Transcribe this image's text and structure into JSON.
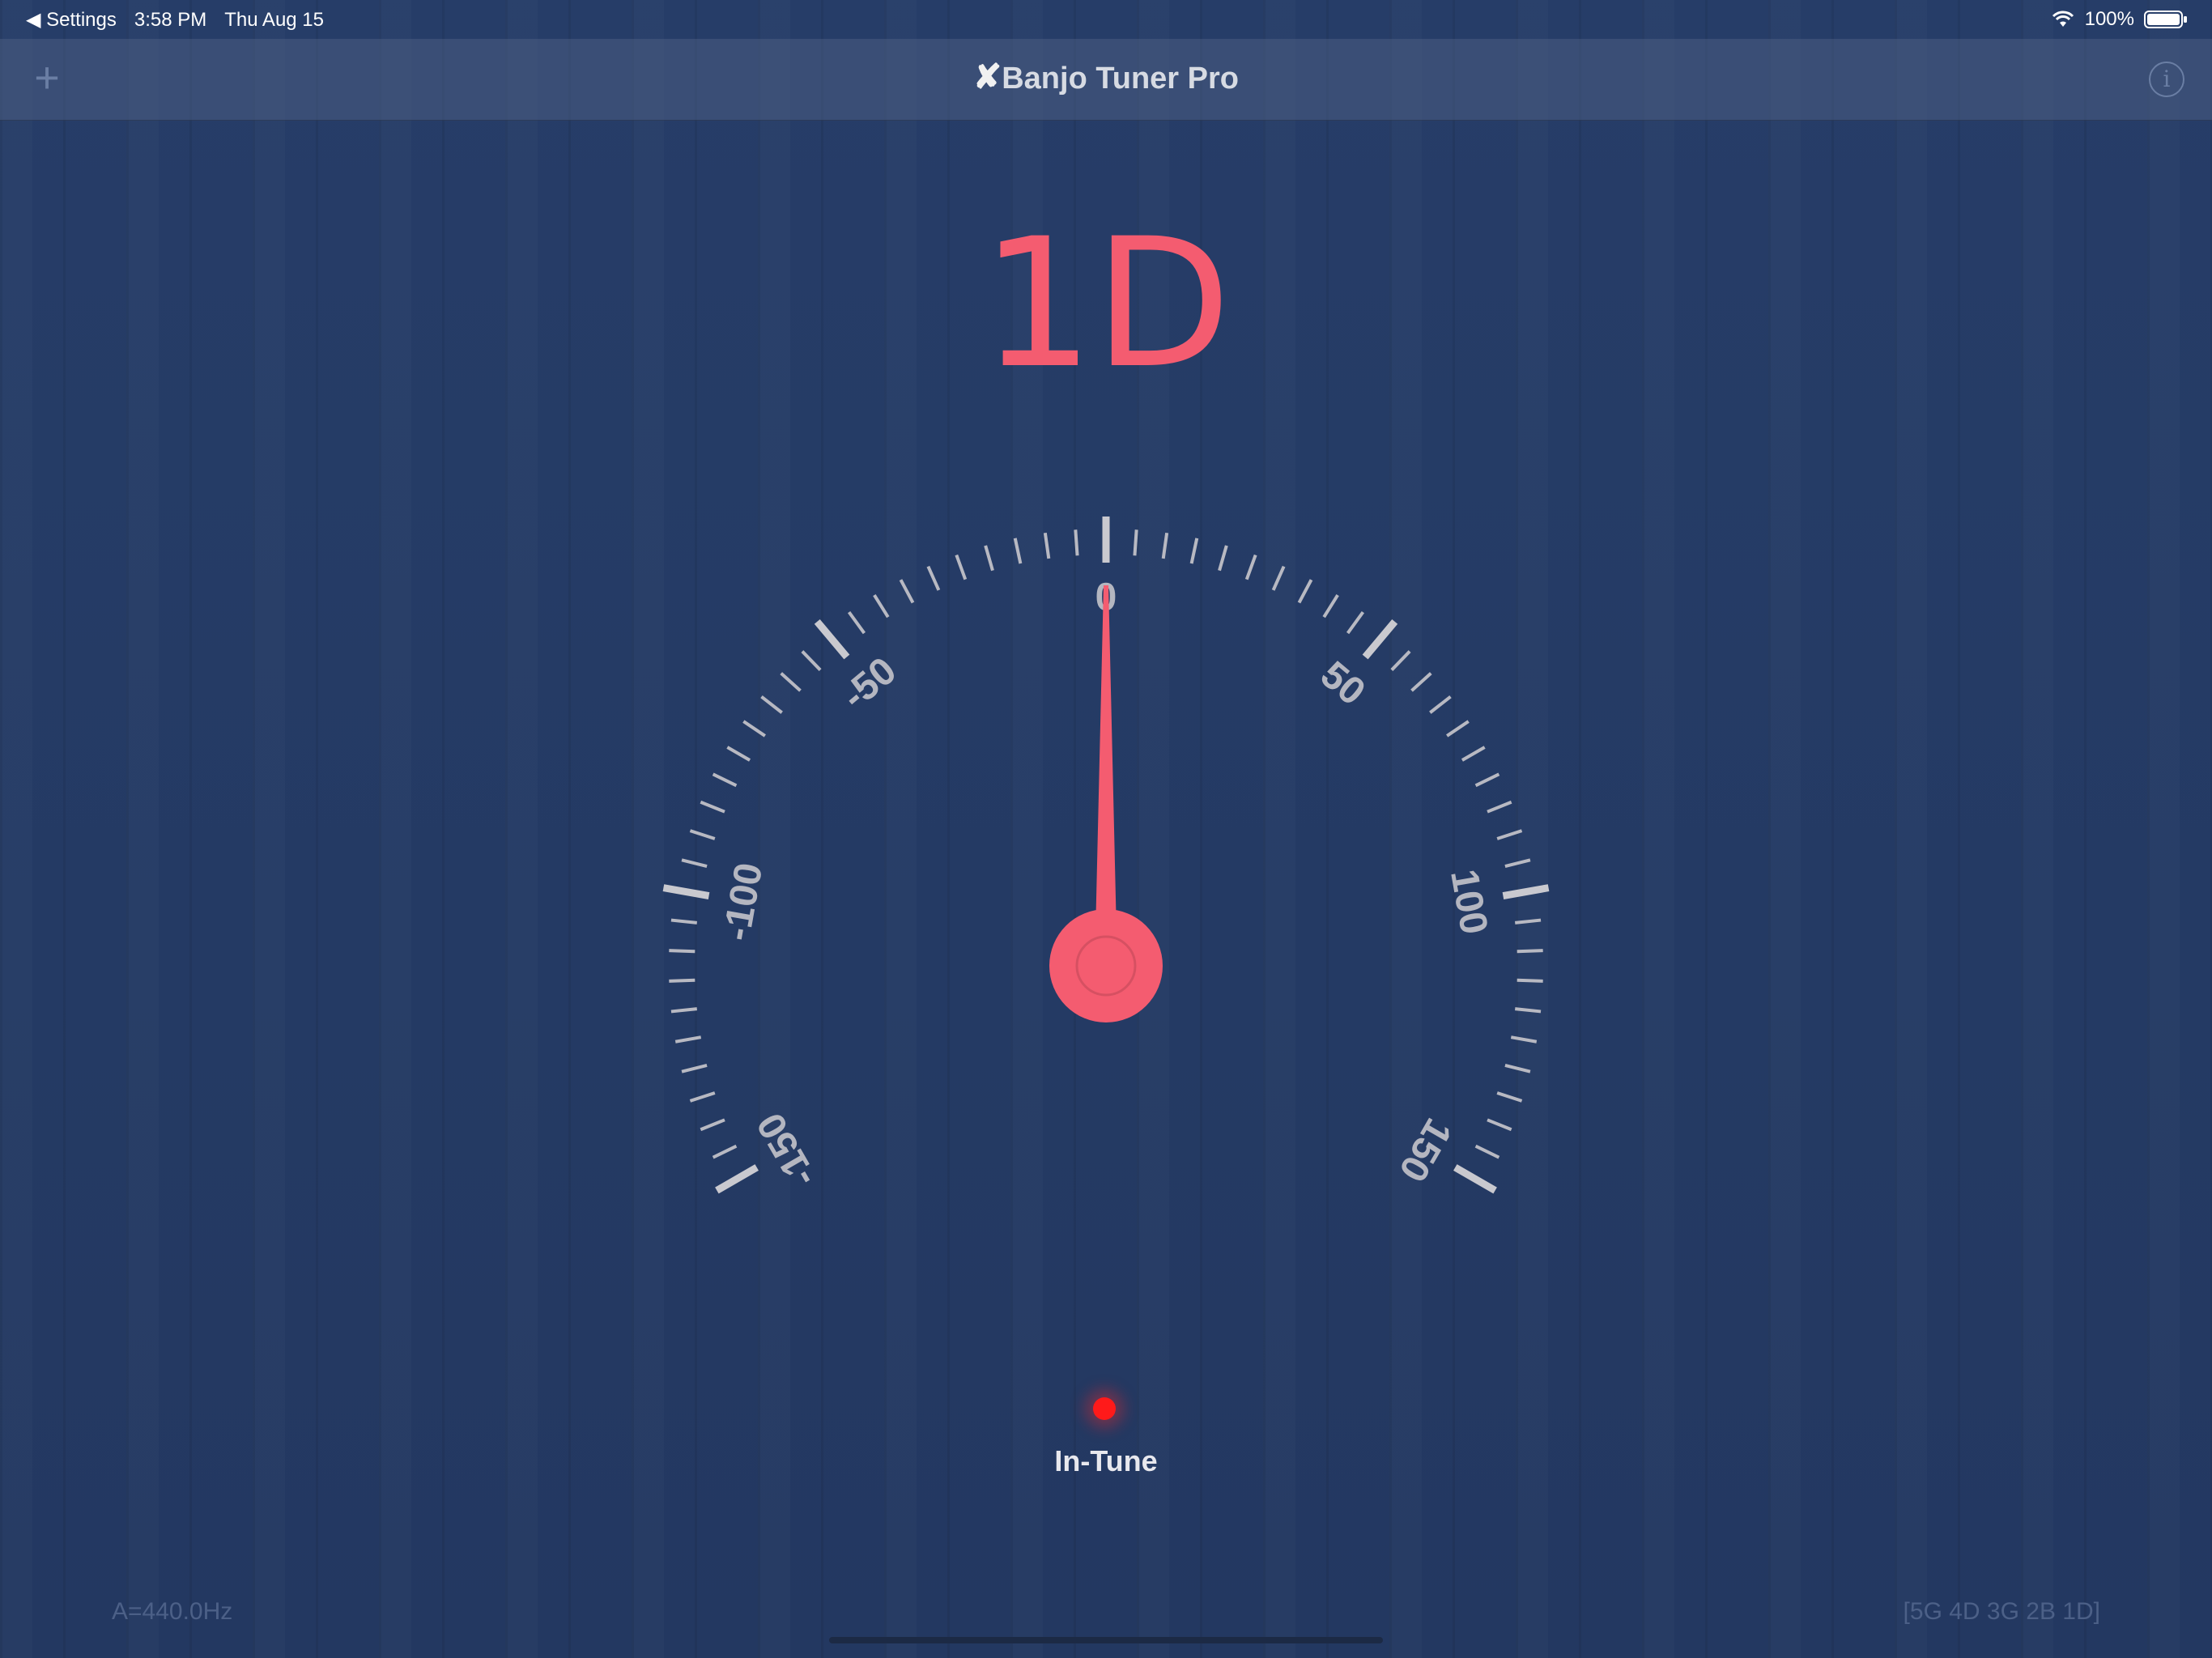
{
  "status_bar": {
    "back_label": "◀ Settings",
    "time": "3:58 PM",
    "date": "Thu Aug 15",
    "battery": "100%"
  },
  "nav": {
    "title_mark": "✘",
    "title": "Banjo Tuner Pro",
    "add_icon": "+",
    "info_icon": "i"
  },
  "tuner": {
    "note": "1D",
    "needle_cents": 0,
    "scale_min": -150,
    "scale_max": 150,
    "scale_labels": [
      "-150",
      "-100",
      "-50",
      "0",
      "50",
      "100",
      "150"
    ],
    "accent_color": "#f45c70",
    "status": "In-Tune",
    "reference": "A=440.0Hz",
    "strings": "[5G 4D 3G 2B 1D]"
  }
}
